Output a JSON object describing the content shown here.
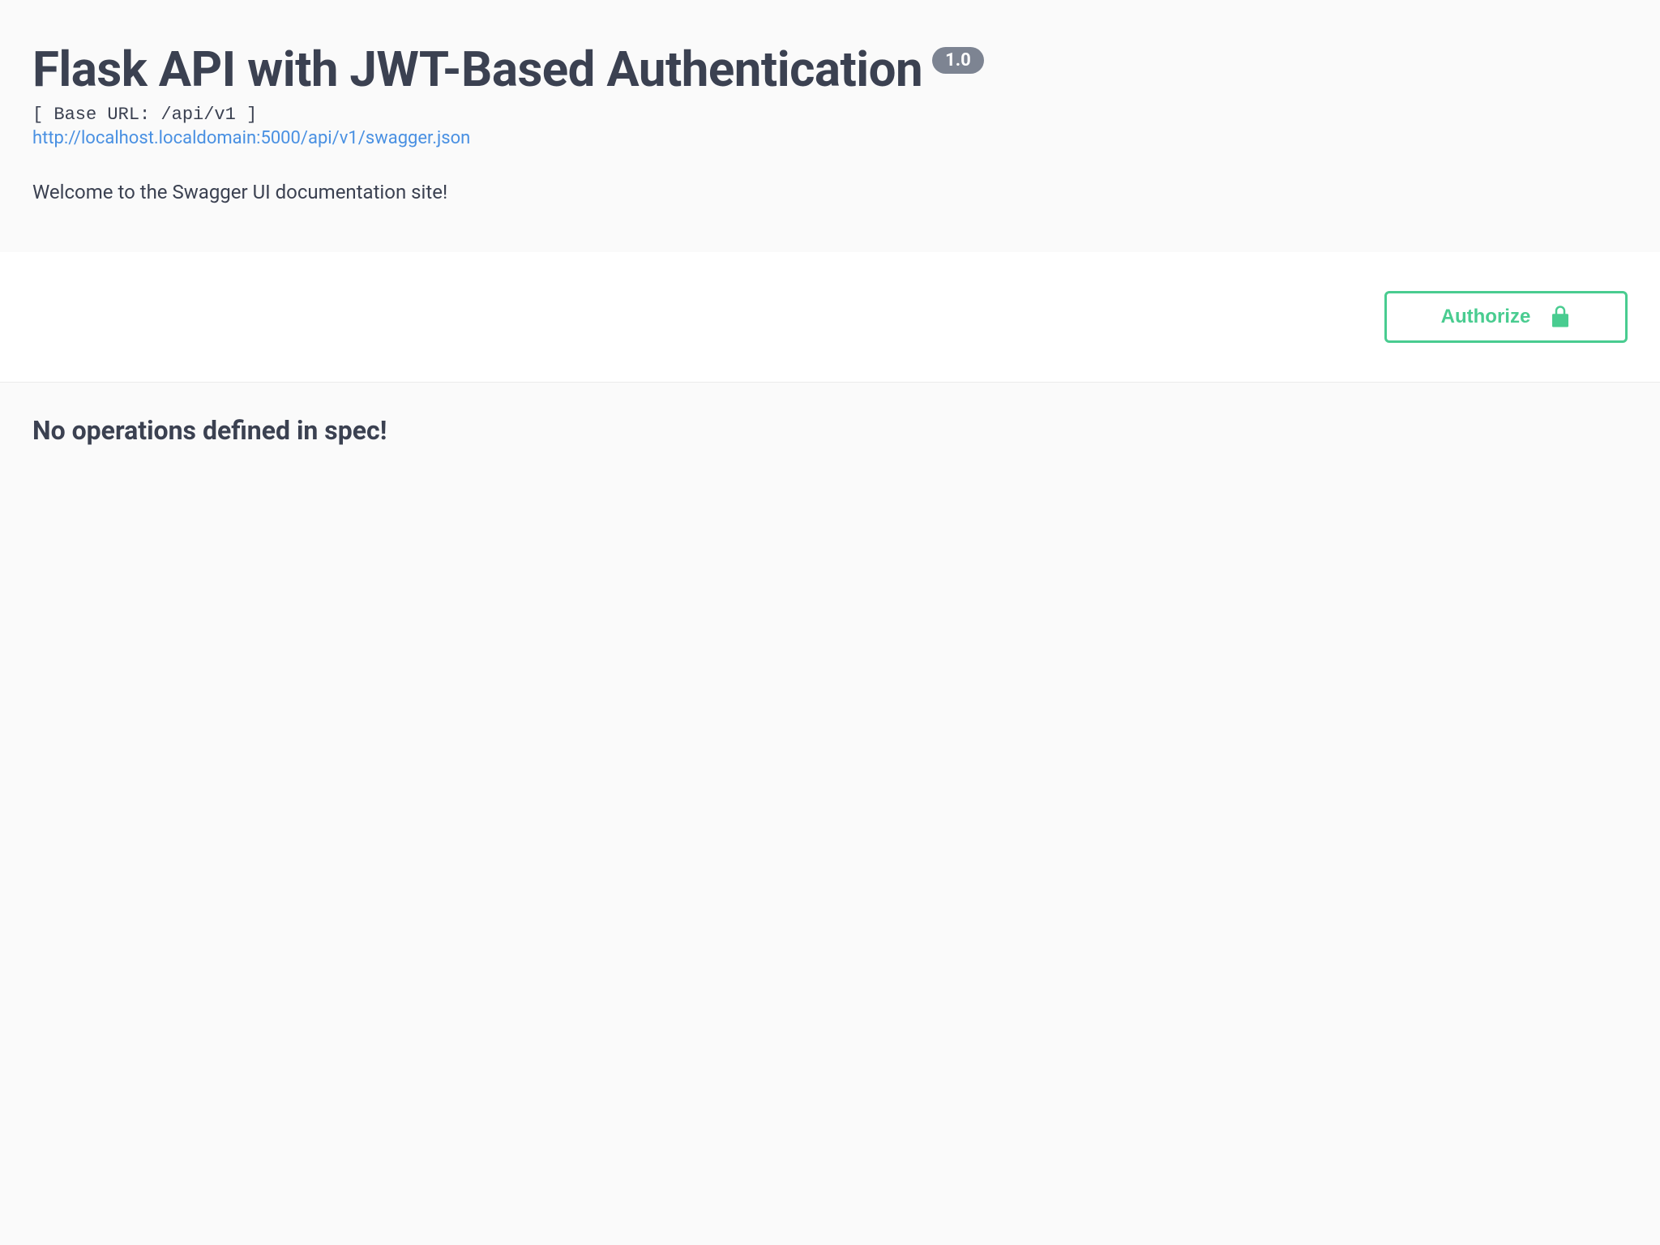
{
  "header": {
    "title": "Flask API with JWT-Based Authentication",
    "version": "1.0",
    "baseUrlLabel": "[ Base URL: /api/v1 ]",
    "apiLink": "http://localhost.localdomain:5000/api/v1/swagger.json",
    "description": "Welcome to the Swagger UI documentation site!"
  },
  "toolbar": {
    "authorizeLabel": "Authorize"
  },
  "content": {
    "emptyMessage": "No operations defined in spec!"
  }
}
